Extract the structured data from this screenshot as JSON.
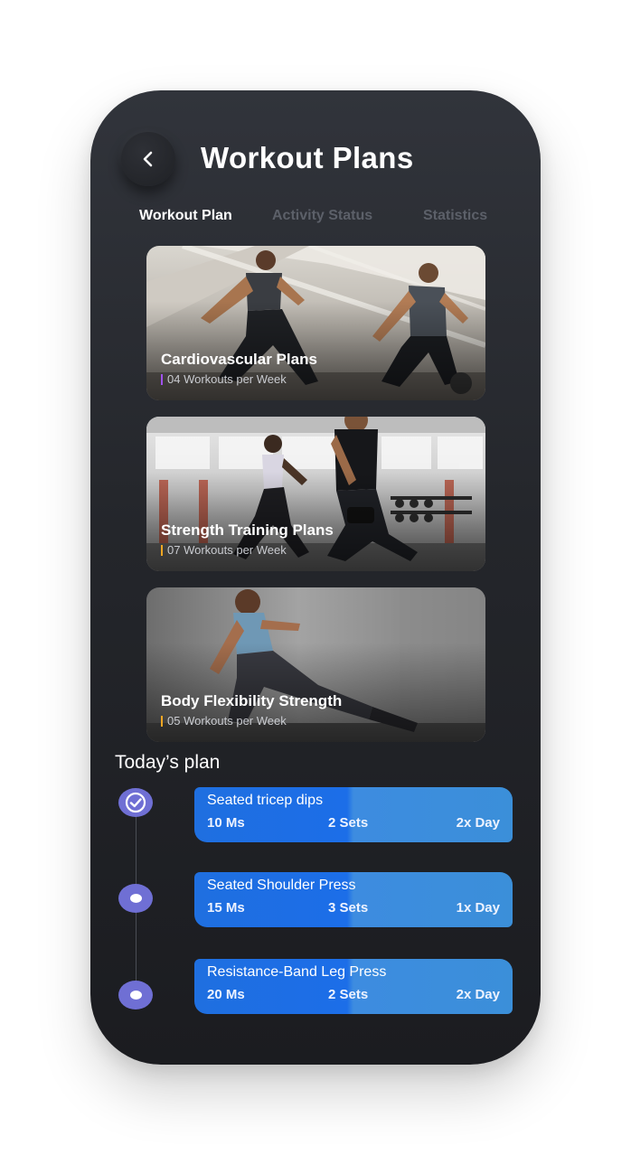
{
  "header": {
    "title": "Workout Plans",
    "back_icon": "chevron-left-icon"
  },
  "tabs": [
    {
      "label": "Workout Plan",
      "active": true
    },
    {
      "label": "Activity Status",
      "active": false
    },
    {
      "label": "Statistics",
      "active": false
    }
  ],
  "plans": [
    {
      "title": "Cardiovascular Plans",
      "subtitle": "04 Workouts per Week",
      "accent": "#a052f0"
    },
    {
      "title": "Strength Training Plans",
      "subtitle": "07 Workouts per Week",
      "accent": "#f2a623"
    },
    {
      "title": "Body Flexibility Strength",
      "subtitle": "05 Workouts per Week",
      "accent": "#f2a623"
    }
  ],
  "today": {
    "heading": "Today’s plan",
    "items": [
      {
        "name": "Seated tricep dips",
        "duration": "10 Ms",
        "sets": "2 Sets",
        "frequency": "2x Day",
        "status": "done",
        "icon": "check-circle-icon"
      },
      {
        "name": "Seated Shoulder Press",
        "duration": "15 Ms",
        "sets": "3 Sets",
        "frequency": "1x Day",
        "status": "pending",
        "icon": "dot-icon"
      },
      {
        "name": "Resistance-Band Leg Press",
        "duration": "20 Ms",
        "sets": "2 Sets",
        "frequency": "2x Day",
        "status": "pending",
        "icon": "dot-icon"
      }
    ]
  },
  "colors": {
    "background": "#ffffff",
    "phone": "#24262b",
    "accent_blue": "#1f6fe0",
    "timeline_node": "#6f6fd4"
  }
}
